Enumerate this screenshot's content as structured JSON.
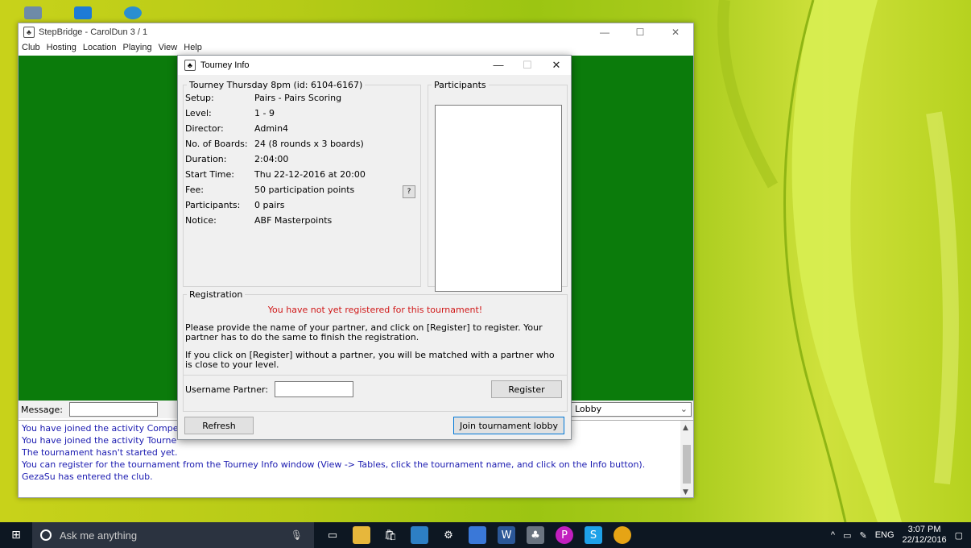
{
  "main_window": {
    "title": "StepBridge - CarolDun 3 / 1",
    "menu": [
      "Club",
      "Hosting",
      "Location",
      "Playing",
      "View",
      "Help"
    ],
    "message_label": "Message:",
    "lobby_select": "Lobby",
    "log": [
      "You have joined the activity Compe",
      "You have joined the activity Tourne",
      "The tournament hasn't started yet.",
      "You can register for the tournament from the Tourney Info window (View -> Tables, click the tournament name, and click on the Info button).",
      "GezaSu has entered the club."
    ]
  },
  "dialog": {
    "title": "Tourney Info",
    "info_legend": "Tourney Thursday 8pm (id: 6104-6167)",
    "rows": [
      {
        "k": "Setup:",
        "v": "Pairs - Pairs Scoring"
      },
      {
        "k": "Level:",
        "v": "1 - 9"
      },
      {
        "k": "Director:",
        "v": "Admin4"
      },
      {
        "k": "No. of Boards:",
        "v": "24 (8 rounds x 3 boards)"
      },
      {
        "k": "Duration:",
        "v": "2:04:00"
      },
      {
        "k": "Start Time:",
        "v": "Thu 22-12-2016 at 20:00"
      },
      {
        "k": "Fee:",
        "v": "50 participation points"
      },
      {
        "k": "Participants:",
        "v": "0 pairs"
      },
      {
        "k": "Notice:",
        "v": "ABF Masterpoints"
      }
    ],
    "help_label": "?",
    "participants_legend": "Participants",
    "registration_legend": "Registration",
    "warning": "You have not yet registered for this tournament!",
    "para1": "Please provide the name of your partner, and click on [Register] to register. Your partner has to do the same to finish the registration.",
    "para2": "If you click on [Register] without a partner, you will be matched with a partner who is close to your level.",
    "partner_label": "Username Partner:",
    "register_label": "Register",
    "refresh_label": "Refresh",
    "join_label": "Join tournament lobby"
  },
  "taskbar": {
    "search_placeholder": "Ask me anything",
    "lang": "ENG",
    "time": "3:07 PM",
    "date": "22/12/2016"
  },
  "colors": {
    "felt_green": "#0b7b0b",
    "warning_red": "#d01818",
    "log_blue": "#1a1ab0",
    "taskbar": "#0d1722"
  }
}
